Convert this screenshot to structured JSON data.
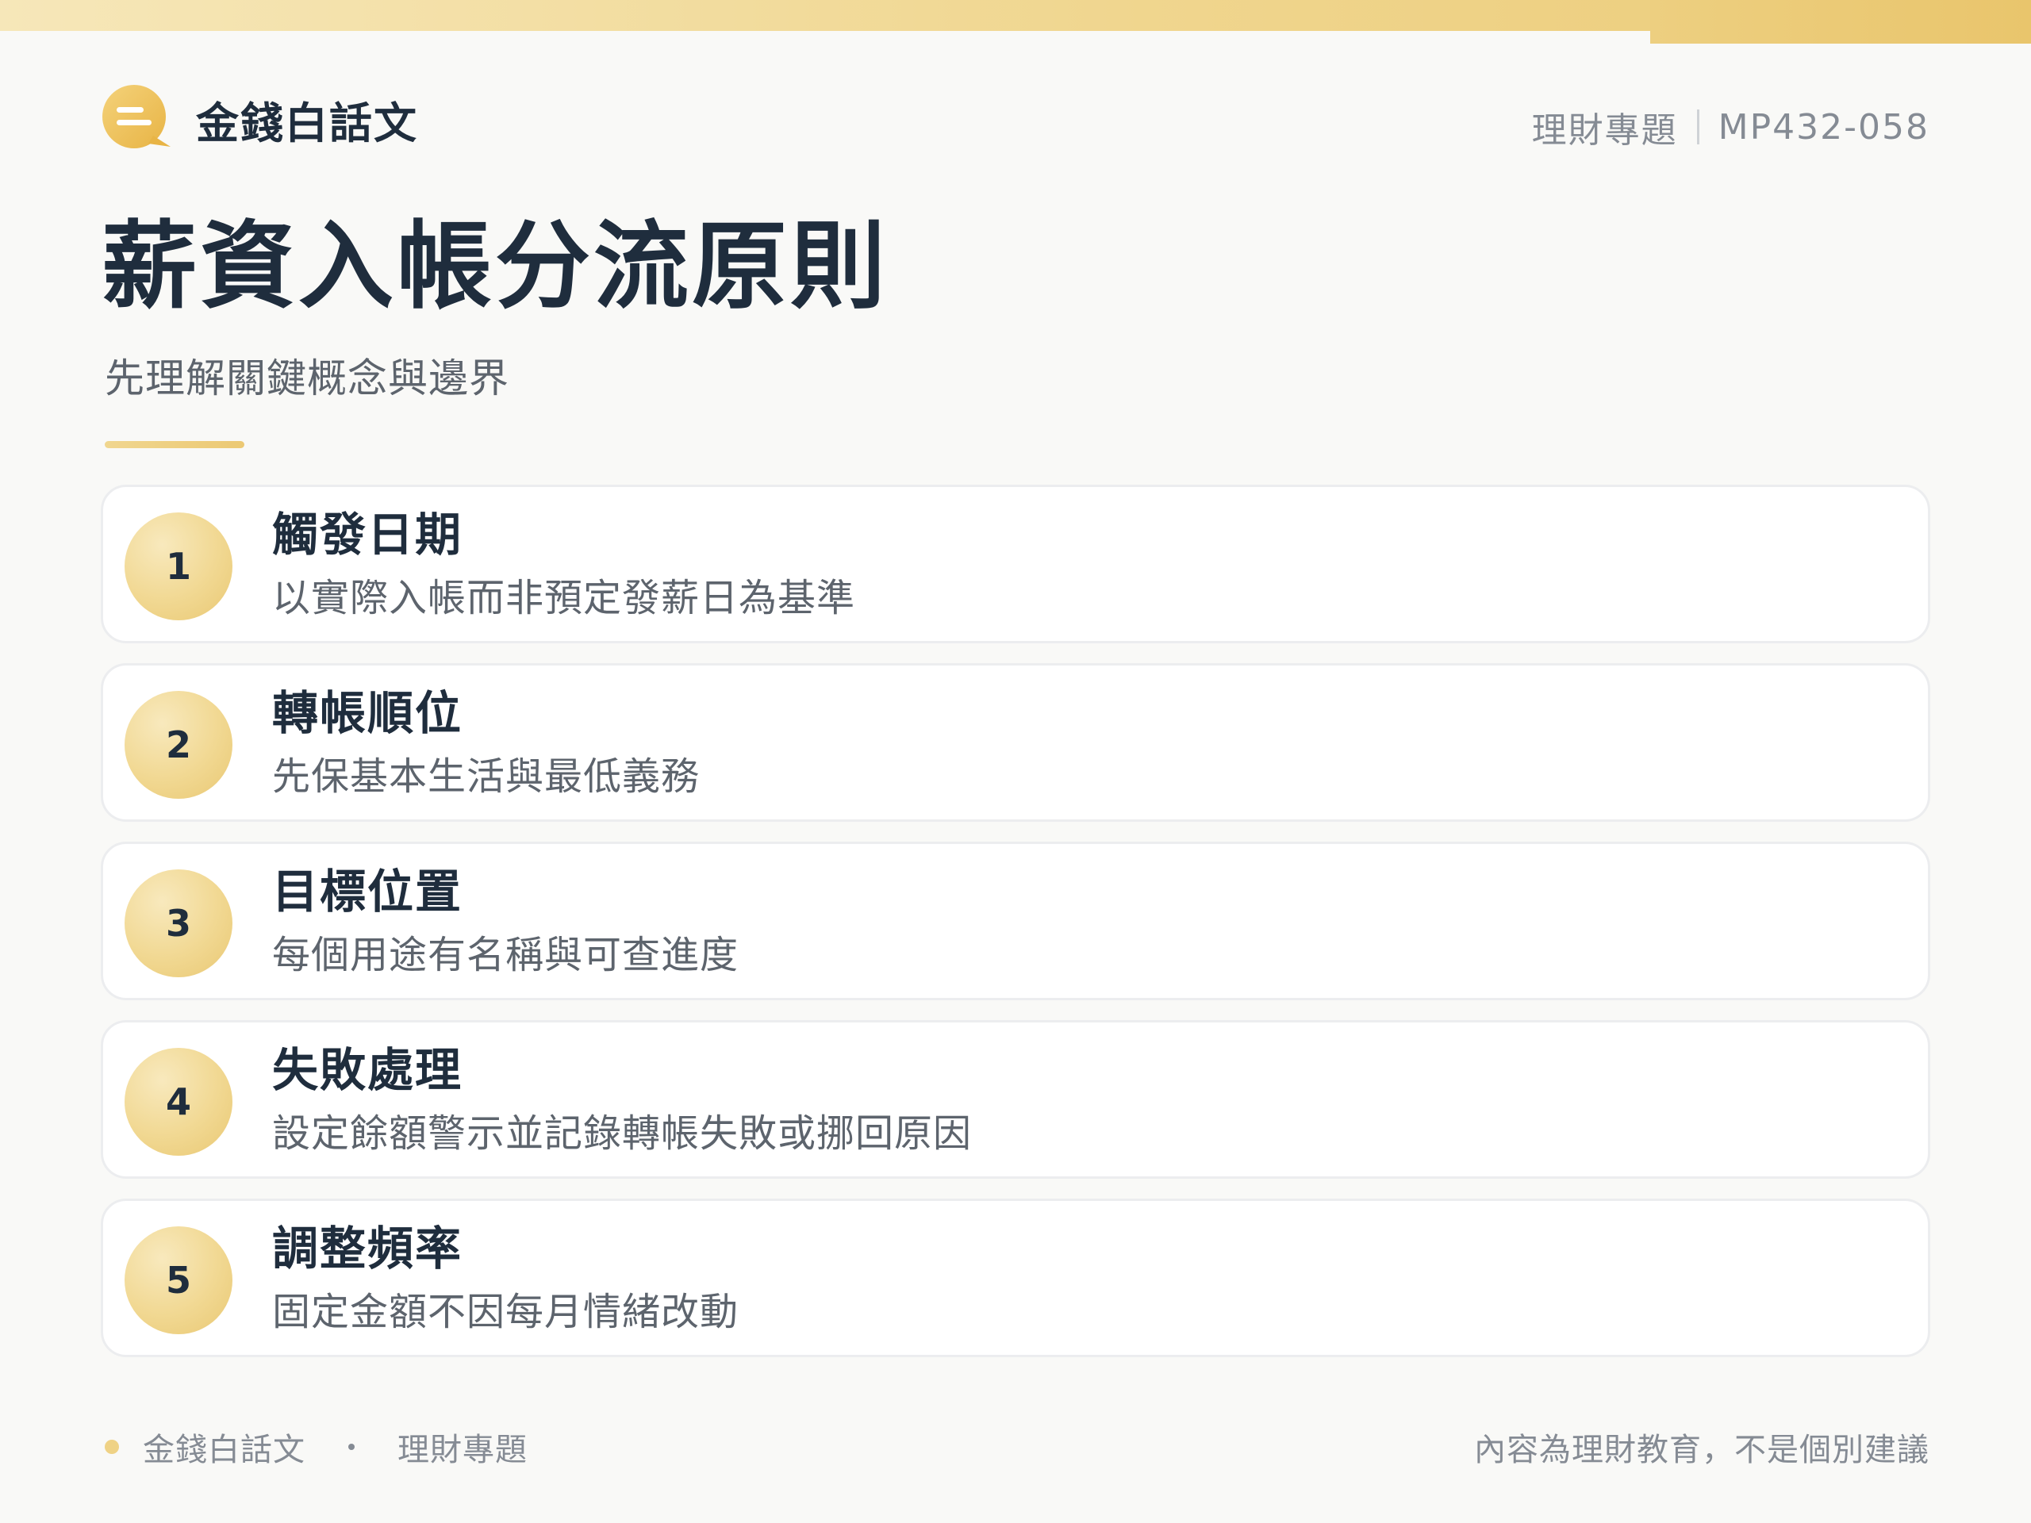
{
  "header": {
    "brand_name": "金錢白話文",
    "brand_icon": "speech-bubble-icon",
    "category": "理財專題",
    "code": "MP432-058"
  },
  "main": {
    "title": "薪資入帳分流原則",
    "subtitle": "先理解關鍵概念與邊界",
    "steps": [
      {
        "number": "1",
        "title": "觸發日期",
        "desc": "以實際入帳而非預定發薪日為基準"
      },
      {
        "number": "2",
        "title": "轉帳順位",
        "desc": "先保基本生活與最低義務"
      },
      {
        "number": "3",
        "title": "目標位置",
        "desc": "每個用途有名稱與可查進度"
      },
      {
        "number": "4",
        "title": "失敗處理",
        "desc": "設定餘額警示並記錄轉帳失敗或挪回原因"
      },
      {
        "number": "5",
        "title": "調整頻率",
        "desc": "固定金額不因每月情緒改動"
      }
    ]
  },
  "footer": {
    "brand": "金錢白話文",
    "category": "理財專題",
    "disclaimer": "內容為理財教育，不是個別建議"
  },
  "colors": {
    "accent": "#efd285",
    "text_dark": "#1f2d3d",
    "text_muted": "#858b94"
  }
}
